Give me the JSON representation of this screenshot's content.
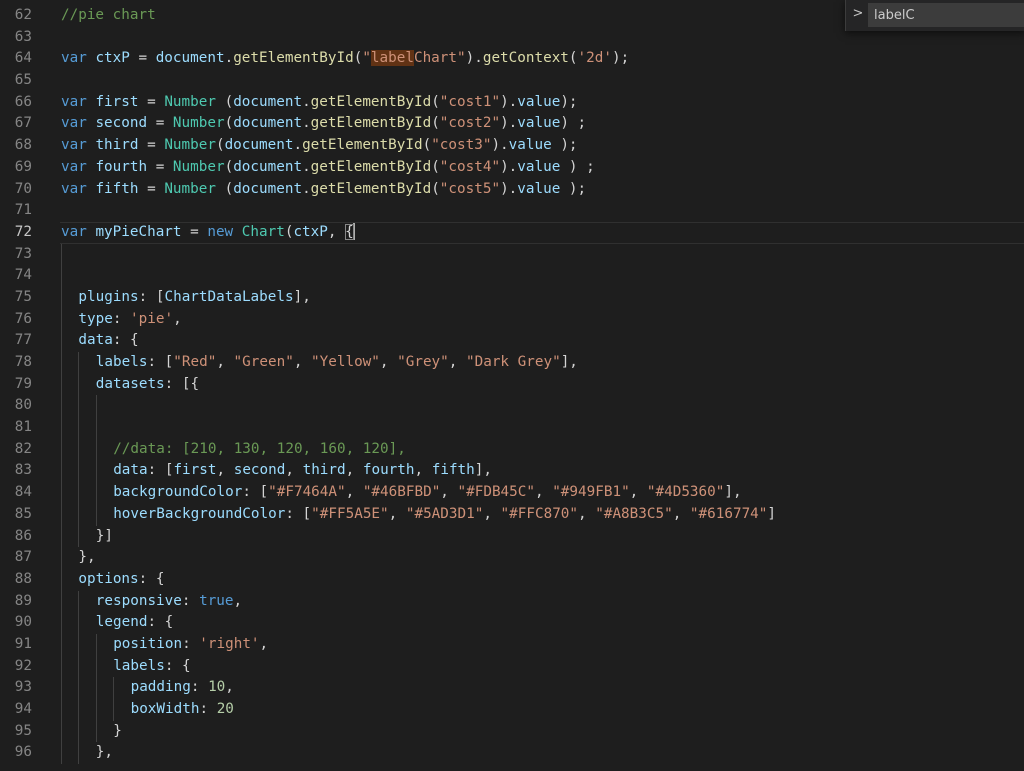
{
  "editor": {
    "lines": [
      {
        "num": "62",
        "indent": 0,
        "tokens": [
          {
            "t": "//pie chart",
            "c": "cm"
          }
        ]
      },
      {
        "num": "63",
        "indent": 0,
        "tokens": []
      },
      {
        "num": "64",
        "indent": 0,
        "tokens": [
          {
            "t": "var",
            "c": "kw"
          },
          {
            "t": " ",
            "c": "p"
          },
          {
            "t": "ctxP",
            "c": "var"
          },
          {
            "t": " = ",
            "c": "p"
          },
          {
            "t": "document",
            "c": "var"
          },
          {
            "t": ".",
            "c": "p"
          },
          {
            "t": "getElementById",
            "c": "fn"
          },
          {
            "t": "(",
            "c": "p"
          },
          {
            "t": "\"",
            "c": "str"
          },
          {
            "t": "label",
            "c": "hl"
          },
          {
            "t": "Chart\"",
            "c": "str"
          },
          {
            "t": ").",
            "c": "p"
          },
          {
            "t": "getContext",
            "c": "fn"
          },
          {
            "t": "(",
            "c": "p"
          },
          {
            "t": "'2d'",
            "c": "str"
          },
          {
            "t": ");",
            "c": "p"
          }
        ]
      },
      {
        "num": "65",
        "indent": 0,
        "tokens": []
      },
      {
        "num": "66",
        "indent": 0,
        "tokens": [
          {
            "t": "var",
            "c": "kw"
          },
          {
            "t": " ",
            "c": "p"
          },
          {
            "t": "first",
            "c": "var"
          },
          {
            "t": " = ",
            "c": "p"
          },
          {
            "t": "Number",
            "c": "cls"
          },
          {
            "t": " (",
            "c": "p"
          },
          {
            "t": "document",
            "c": "var"
          },
          {
            "t": ".",
            "c": "p"
          },
          {
            "t": "getElementById",
            "c": "fn"
          },
          {
            "t": "(",
            "c": "p"
          },
          {
            "t": "\"cost1\"",
            "c": "str"
          },
          {
            "t": ").",
            "c": "p"
          },
          {
            "t": "value",
            "c": "var"
          },
          {
            "t": ");",
            "c": "p"
          }
        ]
      },
      {
        "num": "67",
        "indent": 0,
        "tokens": [
          {
            "t": "var",
            "c": "kw"
          },
          {
            "t": " ",
            "c": "p"
          },
          {
            "t": "second",
            "c": "var"
          },
          {
            "t": " = ",
            "c": "p"
          },
          {
            "t": "Number",
            "c": "cls"
          },
          {
            "t": "(",
            "c": "p"
          },
          {
            "t": "document",
            "c": "var"
          },
          {
            "t": ".",
            "c": "p"
          },
          {
            "t": "getElementById",
            "c": "fn"
          },
          {
            "t": "(",
            "c": "p"
          },
          {
            "t": "\"cost2\"",
            "c": "str"
          },
          {
            "t": ").",
            "c": "p"
          },
          {
            "t": "value",
            "c": "var"
          },
          {
            "t": ") ;",
            "c": "p"
          }
        ]
      },
      {
        "num": "68",
        "indent": 0,
        "tokens": [
          {
            "t": "var",
            "c": "kw"
          },
          {
            "t": " ",
            "c": "p"
          },
          {
            "t": "third",
            "c": "var"
          },
          {
            "t": " = ",
            "c": "p"
          },
          {
            "t": "Number",
            "c": "cls"
          },
          {
            "t": "(",
            "c": "p"
          },
          {
            "t": "document",
            "c": "var"
          },
          {
            "t": ".",
            "c": "p"
          },
          {
            "t": "getElementById",
            "c": "fn"
          },
          {
            "t": "(",
            "c": "p"
          },
          {
            "t": "\"cost3\"",
            "c": "str"
          },
          {
            "t": ").",
            "c": "p"
          },
          {
            "t": "value",
            "c": "var"
          },
          {
            "t": " );",
            "c": "p"
          }
        ]
      },
      {
        "num": "69",
        "indent": 0,
        "tokens": [
          {
            "t": "var",
            "c": "kw"
          },
          {
            "t": " ",
            "c": "p"
          },
          {
            "t": "fourth",
            "c": "var"
          },
          {
            "t": " = ",
            "c": "p"
          },
          {
            "t": "Number",
            "c": "cls"
          },
          {
            "t": "(",
            "c": "p"
          },
          {
            "t": "document",
            "c": "var"
          },
          {
            "t": ".",
            "c": "p"
          },
          {
            "t": "getElementById",
            "c": "fn"
          },
          {
            "t": "(",
            "c": "p"
          },
          {
            "t": "\"cost4\"",
            "c": "str"
          },
          {
            "t": ").",
            "c": "p"
          },
          {
            "t": "value",
            "c": "var"
          },
          {
            "t": " ) ;",
            "c": "p"
          }
        ]
      },
      {
        "num": "70",
        "indent": 0,
        "tokens": [
          {
            "t": "var",
            "c": "kw"
          },
          {
            "t": " ",
            "c": "p"
          },
          {
            "t": "fifth",
            "c": "var"
          },
          {
            "t": " = ",
            "c": "p"
          },
          {
            "t": "Number",
            "c": "cls"
          },
          {
            "t": " (",
            "c": "p"
          },
          {
            "t": "document",
            "c": "var"
          },
          {
            "t": ".",
            "c": "p"
          },
          {
            "t": "getElementById",
            "c": "fn"
          },
          {
            "t": "(",
            "c": "p"
          },
          {
            "t": "\"cost5\"",
            "c": "str"
          },
          {
            "t": ").",
            "c": "p"
          },
          {
            "t": "value",
            "c": "var"
          },
          {
            "t": " );",
            "c": "p"
          }
        ]
      },
      {
        "num": "71",
        "indent": 0,
        "tokens": []
      },
      {
        "num": "72",
        "indent": 0,
        "current": true,
        "tokens": [
          {
            "t": "var",
            "c": "kw"
          },
          {
            "t": " ",
            "c": "p"
          },
          {
            "t": "myPieChart",
            "c": "var"
          },
          {
            "t": " = ",
            "c": "p"
          },
          {
            "t": "new",
            "c": "kw"
          },
          {
            "t": " ",
            "c": "p"
          },
          {
            "t": "Chart",
            "c": "cls"
          },
          {
            "t": "(",
            "c": "p"
          },
          {
            "t": "ctxP",
            "c": "var"
          },
          {
            "t": ", ",
            "c": "p"
          },
          {
            "t": "{",
            "c": "br"
          },
          {
            "cursor": true
          }
        ]
      },
      {
        "num": "73",
        "indent": 1,
        "tokens": []
      },
      {
        "num": "74",
        "indent": 1,
        "tokens": []
      },
      {
        "num": "75",
        "indent": 1,
        "tokens": [
          {
            "t": "plugins",
            "c": "var"
          },
          {
            "t": ": [",
            "c": "p"
          },
          {
            "t": "ChartDataLabels",
            "c": "var"
          },
          {
            "t": "],",
            "c": "p"
          }
        ]
      },
      {
        "num": "76",
        "indent": 1,
        "tokens": [
          {
            "t": "type",
            "c": "var"
          },
          {
            "t": ": ",
            "c": "p"
          },
          {
            "t": "'pie'",
            "c": "str"
          },
          {
            "t": ",",
            "c": "p"
          }
        ]
      },
      {
        "num": "77",
        "indent": 1,
        "tokens": [
          {
            "t": "data",
            "c": "var"
          },
          {
            "t": ": {",
            "c": "p"
          }
        ]
      },
      {
        "num": "78",
        "indent": 2,
        "tokens": [
          {
            "t": "labels",
            "c": "var"
          },
          {
            "t": ": [",
            "c": "p"
          },
          {
            "t": "\"Red\"",
            "c": "str"
          },
          {
            "t": ", ",
            "c": "p"
          },
          {
            "t": "\"Green\"",
            "c": "str"
          },
          {
            "t": ", ",
            "c": "p"
          },
          {
            "t": "\"Yellow\"",
            "c": "str"
          },
          {
            "t": ", ",
            "c": "p"
          },
          {
            "t": "\"Grey\"",
            "c": "str"
          },
          {
            "t": ", ",
            "c": "p"
          },
          {
            "t": "\"Dark Grey\"",
            "c": "str"
          },
          {
            "t": "],",
            "c": "p"
          }
        ]
      },
      {
        "num": "79",
        "indent": 2,
        "tokens": [
          {
            "t": "datasets",
            "c": "var"
          },
          {
            "t": ": [{",
            "c": "p"
          }
        ]
      },
      {
        "num": "80",
        "indent": 3,
        "tokens": []
      },
      {
        "num": "81",
        "indent": 3,
        "tokens": []
      },
      {
        "num": "82",
        "indent": 3,
        "tokens": [
          {
            "t": "//data: [210, 130, 120, 160, 120],",
            "c": "cm"
          }
        ]
      },
      {
        "num": "83",
        "indent": 3,
        "tokens": [
          {
            "t": "data",
            "c": "var"
          },
          {
            "t": ": [",
            "c": "p"
          },
          {
            "t": "first",
            "c": "var"
          },
          {
            "t": ", ",
            "c": "p"
          },
          {
            "t": "second",
            "c": "var"
          },
          {
            "t": ", ",
            "c": "p"
          },
          {
            "t": "third",
            "c": "var"
          },
          {
            "t": ", ",
            "c": "p"
          },
          {
            "t": "fourth",
            "c": "var"
          },
          {
            "t": ", ",
            "c": "p"
          },
          {
            "t": "fifth",
            "c": "var"
          },
          {
            "t": "],",
            "c": "p"
          }
        ]
      },
      {
        "num": "84",
        "indent": 3,
        "tokens": [
          {
            "t": "backgroundColor",
            "c": "var"
          },
          {
            "t": ": [",
            "c": "p"
          },
          {
            "t": "\"#F7464A\"",
            "c": "str"
          },
          {
            "t": ", ",
            "c": "p"
          },
          {
            "t": "\"#46BFBD\"",
            "c": "str"
          },
          {
            "t": ", ",
            "c": "p"
          },
          {
            "t": "\"#FDB45C\"",
            "c": "str"
          },
          {
            "t": ", ",
            "c": "p"
          },
          {
            "t": "\"#949FB1\"",
            "c": "str"
          },
          {
            "t": ", ",
            "c": "p"
          },
          {
            "t": "\"#4D5360\"",
            "c": "str"
          },
          {
            "t": "],",
            "c": "p"
          }
        ]
      },
      {
        "num": "85",
        "indent": 3,
        "tokens": [
          {
            "t": "hoverBackgroundColor",
            "c": "var"
          },
          {
            "t": ": [",
            "c": "p"
          },
          {
            "t": "\"#FF5A5E\"",
            "c": "str"
          },
          {
            "t": ", ",
            "c": "p"
          },
          {
            "t": "\"#5AD3D1\"",
            "c": "str"
          },
          {
            "t": ", ",
            "c": "p"
          },
          {
            "t": "\"#FFC870\"",
            "c": "str"
          },
          {
            "t": ", ",
            "c": "p"
          },
          {
            "t": "\"#A8B3C5\"",
            "c": "str"
          },
          {
            "t": ", ",
            "c": "p"
          },
          {
            "t": "\"#616774\"",
            "c": "str"
          },
          {
            "t": "]",
            "c": "p"
          }
        ]
      },
      {
        "num": "86",
        "indent": 2,
        "tokens": [
          {
            "t": "}]",
            "c": "p"
          }
        ]
      },
      {
        "num": "87",
        "indent": 1,
        "tokens": [
          {
            "t": "},",
            "c": "p"
          }
        ]
      },
      {
        "num": "88",
        "indent": 1,
        "tokens": [
          {
            "t": "options",
            "c": "var"
          },
          {
            "t": ": {",
            "c": "p"
          }
        ]
      },
      {
        "num": "89",
        "indent": 2,
        "tokens": [
          {
            "t": "responsive",
            "c": "var"
          },
          {
            "t": ": ",
            "c": "p"
          },
          {
            "t": "true",
            "c": "kw"
          },
          {
            "t": ",",
            "c": "p"
          }
        ]
      },
      {
        "num": "90",
        "indent": 2,
        "tokens": [
          {
            "t": "legend",
            "c": "var"
          },
          {
            "t": ": {",
            "c": "p"
          }
        ]
      },
      {
        "num": "91",
        "indent": 3,
        "tokens": [
          {
            "t": "position",
            "c": "var"
          },
          {
            "t": ": ",
            "c": "p"
          },
          {
            "t": "'right'",
            "c": "str"
          },
          {
            "t": ",",
            "c": "p"
          }
        ]
      },
      {
        "num": "92",
        "indent": 3,
        "tokens": [
          {
            "t": "labels",
            "c": "var"
          },
          {
            "t": ": {",
            "c": "p"
          }
        ]
      },
      {
        "num": "93",
        "indent": 4,
        "tokens": [
          {
            "t": "padding",
            "c": "var"
          },
          {
            "t": ": ",
            "c": "p"
          },
          {
            "t": "10",
            "c": "num"
          },
          {
            "t": ",",
            "c": "p"
          }
        ]
      },
      {
        "num": "94",
        "indent": 4,
        "tokens": [
          {
            "t": "boxWidth",
            "c": "var"
          },
          {
            "t": ": ",
            "c": "p"
          },
          {
            "t": "20",
            "c": "num"
          }
        ]
      },
      {
        "num": "95",
        "indent": 3,
        "tokens": [
          {
            "t": "}",
            "c": "p"
          }
        ]
      },
      {
        "num": "96",
        "indent": 2,
        "tokens": [
          {
            "t": "},",
            "c": "p"
          }
        ]
      }
    ]
  },
  "find": {
    "toggle_icon": "chevron-right-icon",
    "toggle_glyph": ">",
    "query": "labelC"
  },
  "colors": {
    "background": "#1e1e1e",
    "keyword": "#569cd6",
    "variable": "#9cdcfe",
    "function": "#dcdcaa",
    "class": "#4ec9b0",
    "string": "#ce9178",
    "number": "#b5cea8",
    "comment": "#6a9955",
    "match_highlight": "#613214"
  }
}
